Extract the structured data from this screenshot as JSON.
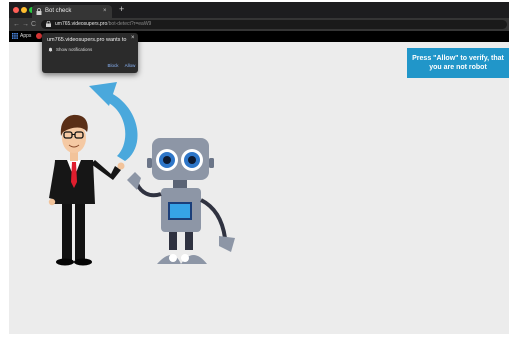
{
  "browser": {
    "tab": {
      "title": "Bot check",
      "close_glyph": "×"
    },
    "new_tab_glyph": "+",
    "nav": {
      "back_glyph": "←",
      "forward_glyph": "→",
      "reload_glyph": "C"
    },
    "address": {
      "host": "um765.videosupers.pro",
      "path": "/bot-detect?r=eaW9"
    },
    "bookmarks": {
      "apps_label": "Apps"
    }
  },
  "permission_popup": {
    "title": "um765.videosupers.pro wants to",
    "item_label": "Show notifications",
    "block_label": "Block",
    "allow_label": "Allow",
    "close_glyph": "×"
  },
  "page": {
    "banner_text": "Press \"Allow\" to verify, that you are not robot"
  },
  "colors": {
    "page_background": "#ececec",
    "banner": "#2196c9",
    "arrow": "#4aa8dc",
    "suit": "#111111",
    "tie": "#e01e2e",
    "robot_body": "#8d96a6",
    "robot_eye": "#2e76c8"
  },
  "icons": [
    "close-icon",
    "lock-icon",
    "bell-icon",
    "apps-grid-icon",
    "back-arrow-icon",
    "forward-arrow-icon",
    "reload-icon"
  ]
}
